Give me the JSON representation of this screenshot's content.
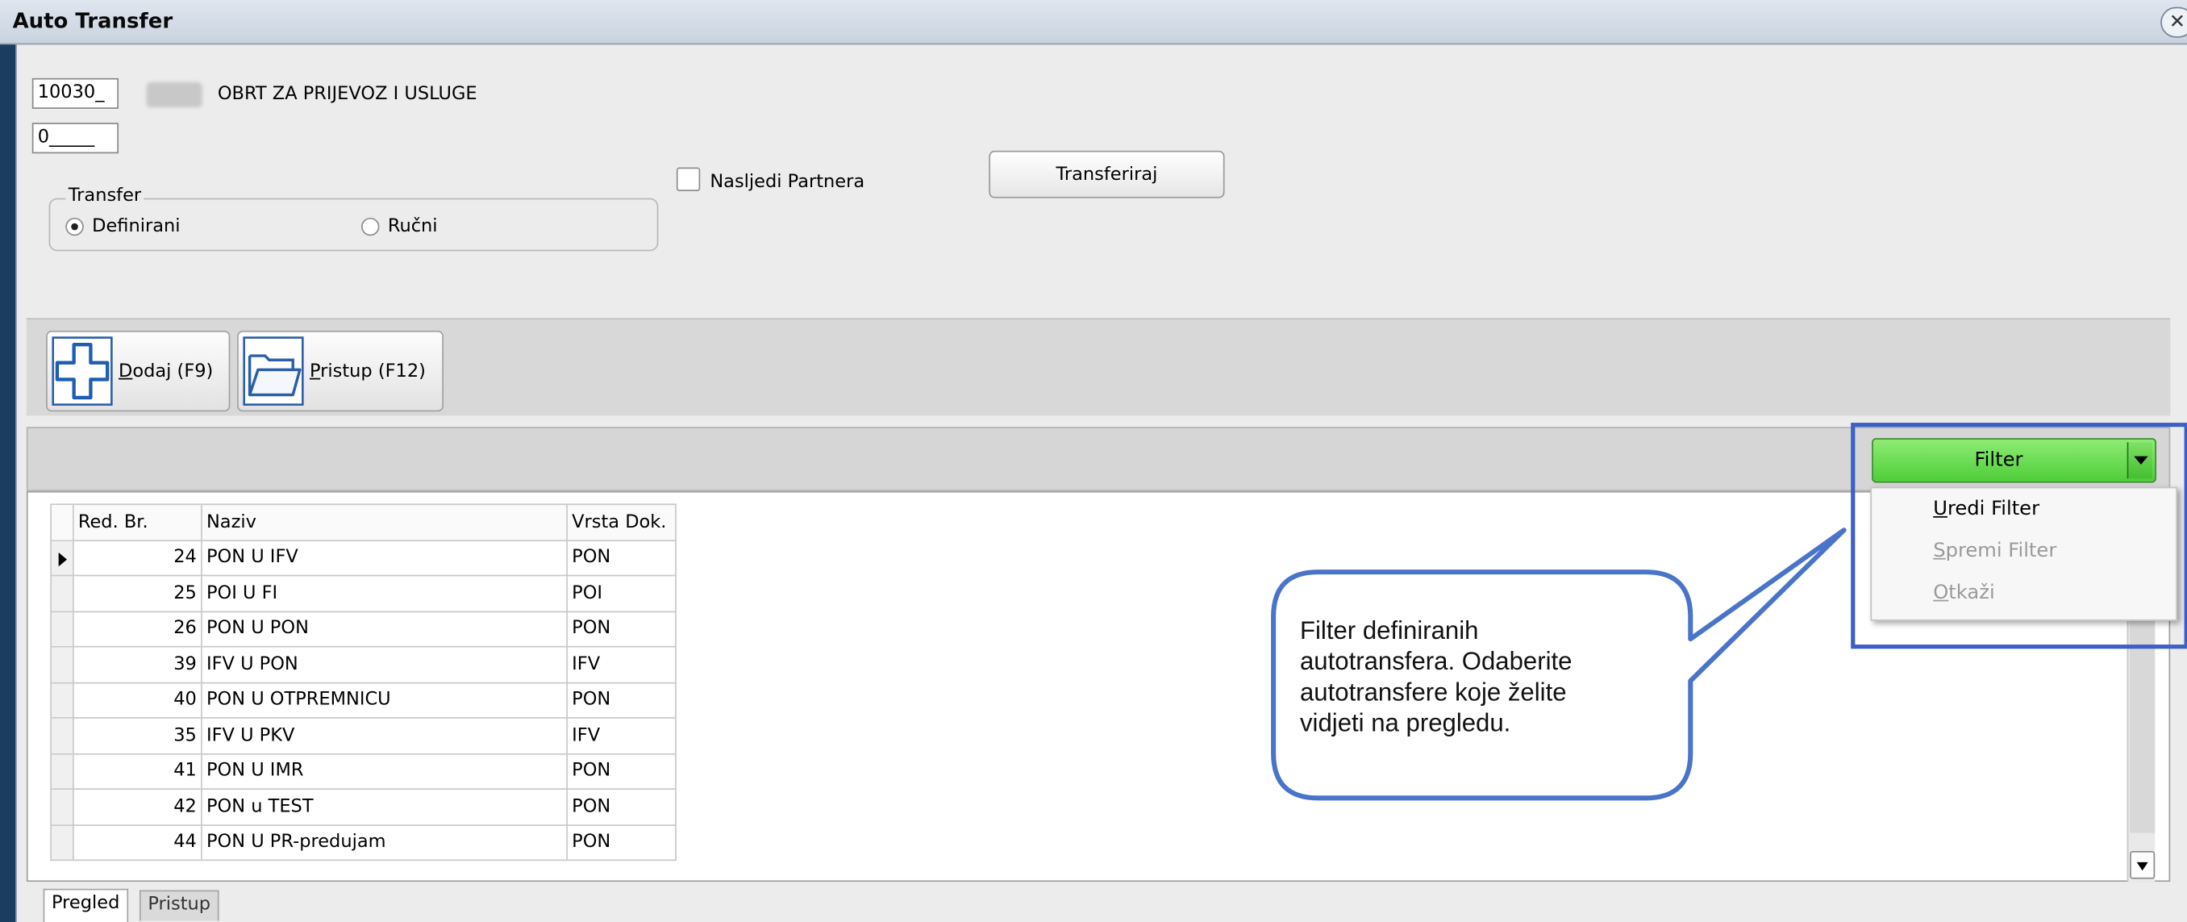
{
  "window": {
    "title": "Auto Transfer",
    "close_glyph": "✕"
  },
  "header": {
    "partner_code": "10030_",
    "partner_name": "OBRT ZA PRIJEVOZ I USLUGE",
    "secondary_code": "0_____",
    "transfer_group": {
      "legend": "Transfer",
      "options": [
        {
          "label": "Definirani",
          "selected": true
        },
        {
          "label": "Ručni",
          "selected": false
        }
      ]
    },
    "inherit_partner": {
      "label": "Nasljedi Partnera",
      "checked": false
    },
    "transfer_button": "Transferiraj"
  },
  "toolbar": {
    "add": {
      "shortcut_letter": "D",
      "label_rest": "odaj (F9)",
      "icon": "plus-icon"
    },
    "access": {
      "shortcut_letter": "P",
      "label_rest": "ristup (F12)",
      "icon": "folder-icon"
    }
  },
  "filter": {
    "button_label": "Filter",
    "menu_items": [
      {
        "accel": "U",
        "rest": "redi Filter",
        "enabled": true
      },
      {
        "accel": "S",
        "rest": "premi Filter",
        "enabled": false
      },
      {
        "accel": "O",
        "rest": "tkaži",
        "enabled": false
      }
    ]
  },
  "grid": {
    "columns": [
      "Red. Br.",
      "Naziv",
      "Vrsta Dok."
    ],
    "rows": [
      {
        "no": "24",
        "naziv": "PON U IFV",
        "vrsta": "PON",
        "current": true
      },
      {
        "no": "25",
        "naziv": "POI U FI",
        "vrsta": "POI"
      },
      {
        "no": "26",
        "naziv": "PON U PON",
        "vrsta": "PON"
      },
      {
        "no": "39",
        "naziv": "IFV U PON",
        "vrsta": "IFV"
      },
      {
        "no": "40",
        "naziv": "PON U OTPREMNICU",
        "vrsta": "PON"
      },
      {
        "no": "35",
        "naziv": "IFV U PKV",
        "vrsta": "IFV"
      },
      {
        "no": "41",
        "naziv": "PON U IMR",
        "vrsta": "PON"
      },
      {
        "no": "42",
        "naziv": "PON u TEST",
        "vrsta": "PON"
      },
      {
        "no": "44",
        "naziv": "PON U PR-predujam",
        "vrsta": "PON"
      }
    ]
  },
  "tabs": [
    {
      "label": "Pregled",
      "active": true
    },
    {
      "label": "Pristup",
      "active": false
    }
  ],
  "callout": {
    "lines": [
      "Filter definiranih",
      "autotransfera. Odaberite",
      "autotransfere koje želite",
      "vidjeti na pregledu."
    ]
  },
  "colors": {
    "filter_green": "#5fd648",
    "highlight_blue": "#3d5fc8",
    "desktop": "#1a3a5c"
  }
}
